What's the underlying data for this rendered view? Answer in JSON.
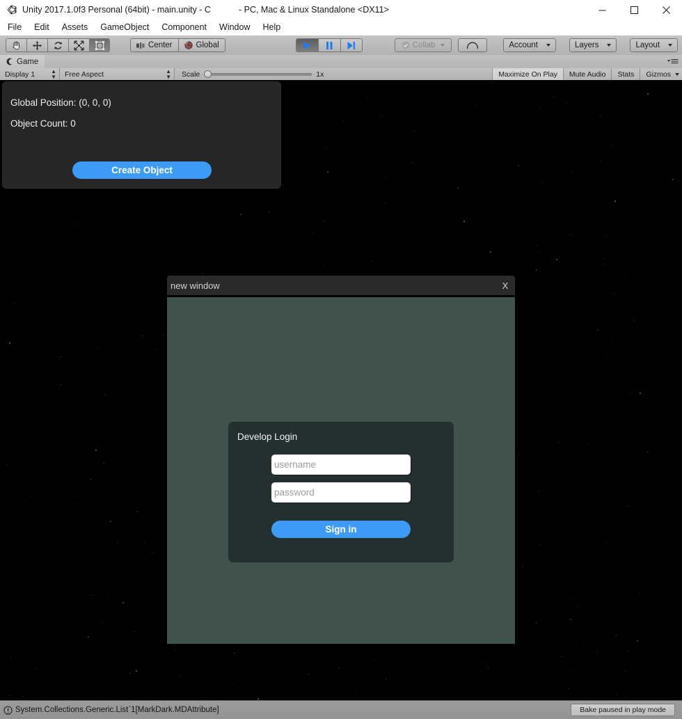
{
  "window": {
    "title_left": "Unity 2017.1.0f3 Personal (64bit) - main.unity - C",
    "title_right": "- PC, Mac & Linux Standalone <DX11>",
    "logo_icon": "unity-logo-icon",
    "controls": [
      {
        "name": "minimize-button",
        "icon": "minimize-icon"
      },
      {
        "name": "maximize-button",
        "icon": "maximize-icon"
      },
      {
        "name": "close-button",
        "icon": "close-icon"
      }
    ]
  },
  "menubar": {
    "items": [
      {
        "label": "File"
      },
      {
        "label": "Edit"
      },
      {
        "label": "Assets"
      },
      {
        "label": "GameObject"
      },
      {
        "label": "Component"
      },
      {
        "label": "Window"
      },
      {
        "label": "Help"
      }
    ]
  },
  "toolbar": {
    "transform_tools": [
      {
        "name": "hand-tool",
        "icon": "hand-icon",
        "active": false
      },
      {
        "name": "move-tool",
        "icon": "move-arrows-icon",
        "active": false
      },
      {
        "name": "rotate-tool",
        "icon": "rotate-icon",
        "active": false
      },
      {
        "name": "scale-tool",
        "icon": "scale-icon",
        "active": false
      },
      {
        "name": "rect-tool",
        "icon": "rect-transform-icon",
        "active": true
      }
    ],
    "pivot_label": "Center",
    "pivot_icon": "pivot-center-icon",
    "rotation_label": "Global",
    "rotation_icon": "globe-icon",
    "playback": [
      {
        "name": "play-button",
        "icon": "play-icon",
        "active": true
      },
      {
        "name": "pause-button",
        "icon": "pause-icon",
        "active": false
      },
      {
        "name": "step-button",
        "icon": "step-icon",
        "active": false
      }
    ],
    "collab_label": "Collab",
    "collab_icon": "collab-check-icon",
    "cloud_icon": "cloud-icon",
    "account_label": "Account",
    "layers_label": "Layers",
    "layout_label": "Layout"
  },
  "game_panel": {
    "tab_label": "Game",
    "tab_icon": "game-view-icon",
    "tab_menu_icon": "panel-menu-icon",
    "display_label": "Display 1",
    "aspect_label": "Free Aspect",
    "scale_label": "Scale",
    "scale_value": "1x",
    "toggles": [
      {
        "label": "Maximize On Play",
        "on": true
      },
      {
        "label": "Mute Audio",
        "on": false
      },
      {
        "label": "Stats",
        "on": false
      },
      {
        "label": "Gizmos",
        "on": false
      }
    ]
  },
  "hud": {
    "global_position": "Global Position: (0, 0, 0)",
    "object_count": "Object Count: 0",
    "create_button": "Create Object"
  },
  "new_window": {
    "title": "new window",
    "close_label": "X",
    "login": {
      "title": "Develop Login",
      "username_placeholder": "username",
      "username_value": "",
      "password_placeholder": "password",
      "password_value": "",
      "signin_label": "Sign in"
    }
  },
  "statusbar": {
    "icon": "warning-icon",
    "message": "System.Collections.Generic.List`1[MarkDark.MDAttribute]",
    "bake_status": "Bake paused in play mode"
  },
  "colors": {
    "accent_blue": "#3d9bf5",
    "play_icon_blue": "#1e7ef0",
    "window_body": "#41524d",
    "login_panel": "#242f2f",
    "hud_panel": "#262626",
    "chrome_grey": "#b6b6b6",
    "status_grey": "#969696"
  }
}
